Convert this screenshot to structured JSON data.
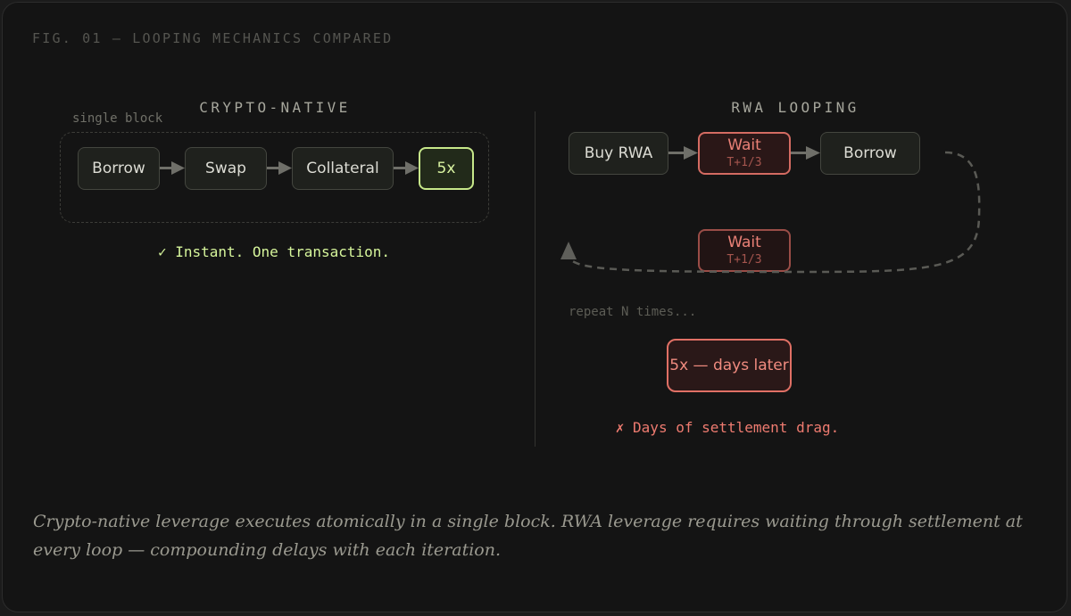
{
  "figure_label": "FIG. 01 — LOOPING MECHANICS COMPARED",
  "crypto": {
    "title": "CRYPTO-NATIVE",
    "block_label": "single block",
    "steps": [
      "Borrow",
      "Swap",
      "Collateral",
      "5x"
    ],
    "status": "✓ Instant. One transaction."
  },
  "rwa": {
    "title": "RWA LOOPING",
    "buy": "Buy RWA",
    "wait1": {
      "label": "Wait",
      "sub": "T+1/3"
    },
    "borrow": "Borrow",
    "wait2": {
      "label": "Wait",
      "sub": "T+1/3"
    },
    "repeat": "repeat N times...",
    "result": "5x — days later",
    "status": "✗ Days of settlement drag."
  },
  "caption": "Crypto-native leverage executes atomically in a single block. RWA leverage requires waiting through settlement at every loop — compounding delays with each iteration.",
  "colors": {
    "accent_green": "#c7e88a",
    "accent_red": "#d46b62",
    "background": "#141414"
  }
}
